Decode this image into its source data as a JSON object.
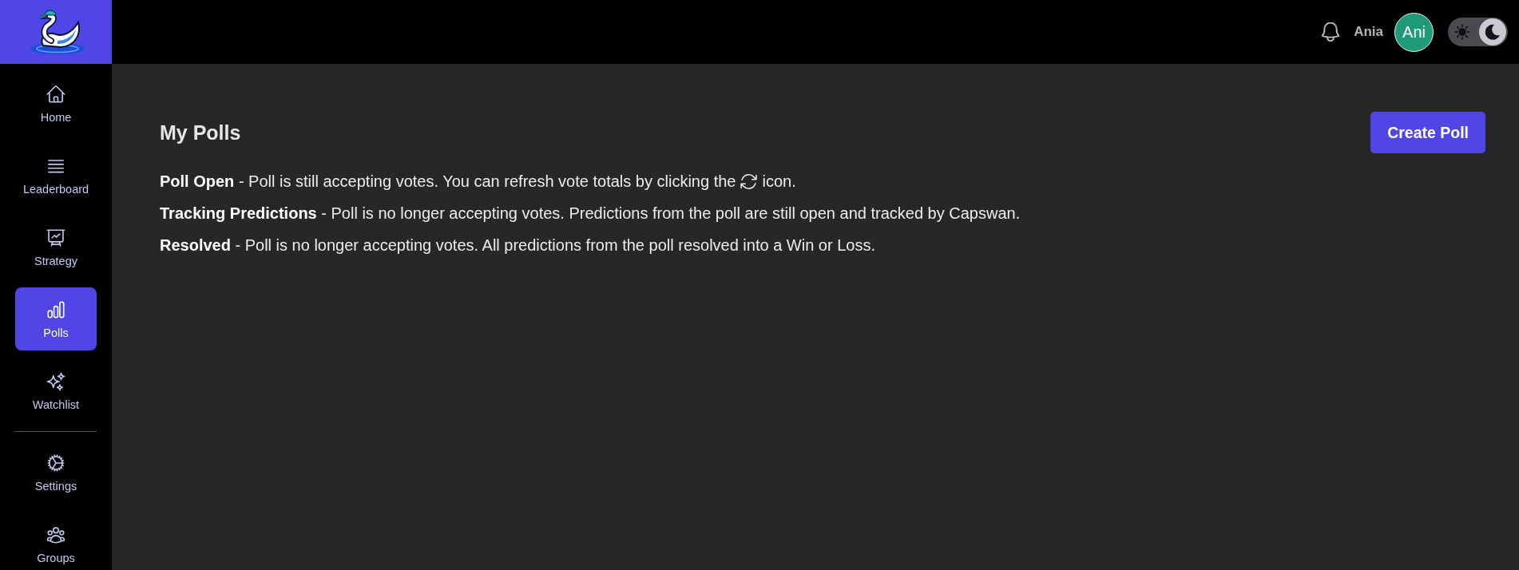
{
  "sidebar": {
    "sections": [
      {
        "items": [
          {
            "label": "Home",
            "selected": false
          },
          {
            "label": "Leaderboard",
            "selected": false
          },
          {
            "label": "Strategy",
            "selected": false
          },
          {
            "label": "Polls",
            "selected": true
          },
          {
            "label": "Watchlist",
            "selected": false
          }
        ]
      },
      {
        "items": [
          {
            "label": "Settings",
            "selected": false
          },
          {
            "label": "Groups",
            "selected": false
          }
        ]
      }
    ]
  },
  "topbar": {
    "user": {
      "name": "Ania",
      "initials": "Ani"
    },
    "theme_toggle": {
      "on": true
    }
  },
  "main": {
    "title": "My Polls",
    "create_button": "Create Poll",
    "legend": [
      {
        "kind": "icon_note",
        "text": "**Poll Open** - Poll is still accepting votes. You can refresh vote totals by clicking the",
        "text_after_icon": "icon."
      },
      {
        "kind": "plain",
        "text": "**Tracking Predictions** - Poll is no longer accepting votes. Predictions from the poll are still open and tracked by Capswan."
      },
      {
        "kind": "plain",
        "text": "**Resolved** - Poll is no longer accepting votes. All predictions from the poll resolved into a Win or Loss."
      }
    ]
  }
}
